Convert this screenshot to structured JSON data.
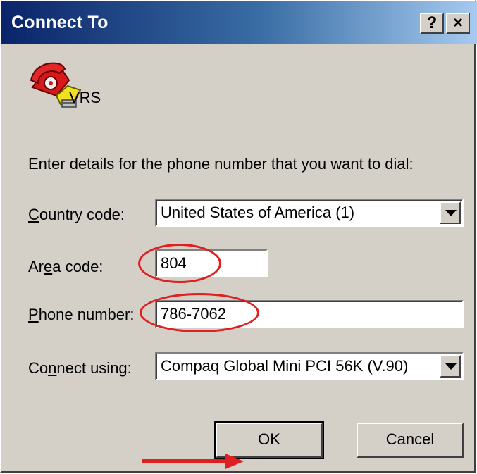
{
  "window": {
    "title": "Connect To",
    "help_label": "?",
    "close_label": "×"
  },
  "connection": {
    "name": "VRS",
    "icon": "telephone-icon"
  },
  "instructions": "Enter details for the phone number that you want to dial:",
  "fields": {
    "country": {
      "label_pre": "",
      "label_ul": "C",
      "label_post": "ountry code:",
      "value": "United States of America (1)"
    },
    "area": {
      "label_pre": "Ar",
      "label_ul": "e",
      "label_post": "a code:",
      "value": "804"
    },
    "phone": {
      "label_pre": "",
      "label_ul": "P",
      "label_post": "hone number:",
      "value": "786-7062"
    },
    "connect": {
      "label_pre": "Co",
      "label_ul": "n",
      "label_post": "nect using:",
      "value": "Compaq Global Mini PCI 56K (V.90)"
    }
  },
  "buttons": {
    "ok": "OK",
    "cancel": "Cancel"
  },
  "annotations": {
    "color": "#e02020"
  }
}
